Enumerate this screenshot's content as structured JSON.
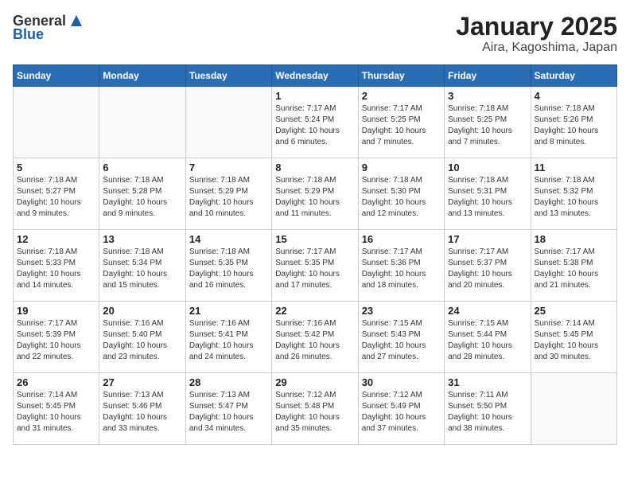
{
  "header": {
    "logo_line1": "General",
    "logo_line2": "Blue",
    "title": "January 2025",
    "subtitle": "Aira, Kagoshima, Japan"
  },
  "calendar": {
    "days_of_week": [
      "Sunday",
      "Monday",
      "Tuesday",
      "Wednesday",
      "Thursday",
      "Friday",
      "Saturday"
    ],
    "weeks": [
      [
        {
          "day": "",
          "info": ""
        },
        {
          "day": "",
          "info": ""
        },
        {
          "day": "",
          "info": ""
        },
        {
          "day": "1",
          "info": "Sunrise: 7:17 AM\nSunset: 5:24 PM\nDaylight: 10 hours\nand 6 minutes."
        },
        {
          "day": "2",
          "info": "Sunrise: 7:17 AM\nSunset: 5:25 PM\nDaylight: 10 hours\nand 7 minutes."
        },
        {
          "day": "3",
          "info": "Sunrise: 7:18 AM\nSunset: 5:25 PM\nDaylight: 10 hours\nand 7 minutes."
        },
        {
          "day": "4",
          "info": "Sunrise: 7:18 AM\nSunset: 5:26 PM\nDaylight: 10 hours\nand 8 minutes."
        }
      ],
      [
        {
          "day": "5",
          "info": "Sunrise: 7:18 AM\nSunset: 5:27 PM\nDaylight: 10 hours\nand 9 minutes."
        },
        {
          "day": "6",
          "info": "Sunrise: 7:18 AM\nSunset: 5:28 PM\nDaylight: 10 hours\nand 9 minutes."
        },
        {
          "day": "7",
          "info": "Sunrise: 7:18 AM\nSunset: 5:29 PM\nDaylight: 10 hours\nand 10 minutes."
        },
        {
          "day": "8",
          "info": "Sunrise: 7:18 AM\nSunset: 5:29 PM\nDaylight: 10 hours\nand 11 minutes."
        },
        {
          "day": "9",
          "info": "Sunrise: 7:18 AM\nSunset: 5:30 PM\nDaylight: 10 hours\nand 12 minutes."
        },
        {
          "day": "10",
          "info": "Sunrise: 7:18 AM\nSunset: 5:31 PM\nDaylight: 10 hours\nand 13 minutes."
        },
        {
          "day": "11",
          "info": "Sunrise: 7:18 AM\nSunset: 5:32 PM\nDaylight: 10 hours\nand 13 minutes."
        }
      ],
      [
        {
          "day": "12",
          "info": "Sunrise: 7:18 AM\nSunset: 5:33 PM\nDaylight: 10 hours\nand 14 minutes."
        },
        {
          "day": "13",
          "info": "Sunrise: 7:18 AM\nSunset: 5:34 PM\nDaylight: 10 hours\nand 15 minutes."
        },
        {
          "day": "14",
          "info": "Sunrise: 7:18 AM\nSunset: 5:35 PM\nDaylight: 10 hours\nand 16 minutes."
        },
        {
          "day": "15",
          "info": "Sunrise: 7:17 AM\nSunset: 5:35 PM\nDaylight: 10 hours\nand 17 minutes."
        },
        {
          "day": "16",
          "info": "Sunrise: 7:17 AM\nSunset: 5:36 PM\nDaylight: 10 hours\nand 18 minutes."
        },
        {
          "day": "17",
          "info": "Sunrise: 7:17 AM\nSunset: 5:37 PM\nDaylight: 10 hours\nand 20 minutes."
        },
        {
          "day": "18",
          "info": "Sunrise: 7:17 AM\nSunset: 5:38 PM\nDaylight: 10 hours\nand 21 minutes."
        }
      ],
      [
        {
          "day": "19",
          "info": "Sunrise: 7:17 AM\nSunset: 5:39 PM\nDaylight: 10 hours\nand 22 minutes."
        },
        {
          "day": "20",
          "info": "Sunrise: 7:16 AM\nSunset: 5:40 PM\nDaylight: 10 hours\nand 23 minutes."
        },
        {
          "day": "21",
          "info": "Sunrise: 7:16 AM\nSunset: 5:41 PM\nDaylight: 10 hours\nand 24 minutes."
        },
        {
          "day": "22",
          "info": "Sunrise: 7:16 AM\nSunset: 5:42 PM\nDaylight: 10 hours\nand 26 minutes."
        },
        {
          "day": "23",
          "info": "Sunrise: 7:15 AM\nSunset: 5:43 PM\nDaylight: 10 hours\nand 27 minutes."
        },
        {
          "day": "24",
          "info": "Sunrise: 7:15 AM\nSunset: 5:44 PM\nDaylight: 10 hours\nand 28 minutes."
        },
        {
          "day": "25",
          "info": "Sunrise: 7:14 AM\nSunset: 5:45 PM\nDaylight: 10 hours\nand 30 minutes."
        }
      ],
      [
        {
          "day": "26",
          "info": "Sunrise: 7:14 AM\nSunset: 5:45 PM\nDaylight: 10 hours\nand 31 minutes."
        },
        {
          "day": "27",
          "info": "Sunrise: 7:13 AM\nSunset: 5:46 PM\nDaylight: 10 hours\nand 33 minutes."
        },
        {
          "day": "28",
          "info": "Sunrise: 7:13 AM\nSunset: 5:47 PM\nDaylight: 10 hours\nand 34 minutes."
        },
        {
          "day": "29",
          "info": "Sunrise: 7:12 AM\nSunset: 5:48 PM\nDaylight: 10 hours\nand 35 minutes."
        },
        {
          "day": "30",
          "info": "Sunrise: 7:12 AM\nSunset: 5:49 PM\nDaylight: 10 hours\nand 37 minutes."
        },
        {
          "day": "31",
          "info": "Sunrise: 7:11 AM\nSunset: 5:50 PM\nDaylight: 10 hours\nand 38 minutes."
        },
        {
          "day": "",
          "info": ""
        }
      ]
    ]
  }
}
